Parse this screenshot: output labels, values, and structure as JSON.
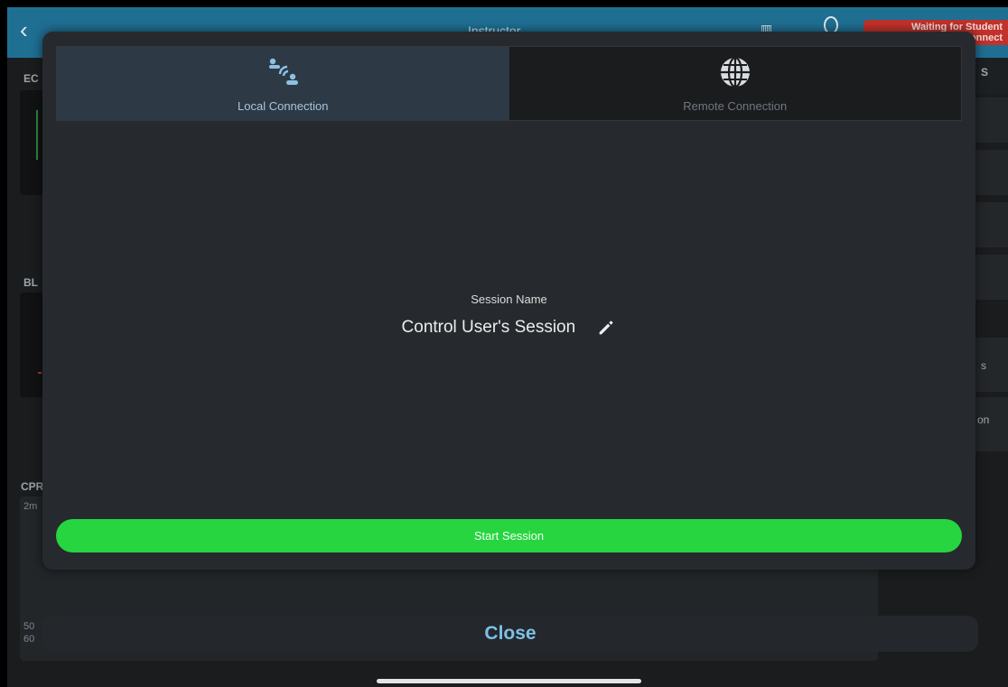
{
  "background": {
    "title": "Instructor",
    "status_badge": "Waiting for Student\nto Connect",
    "labels": {
      "ecg": "EC",
      "blood": "BL",
      "cpr": "CPR",
      "cpr_sub": "2m",
      "bottom_1": "50",
      "bottom_2": "60"
    },
    "right_texts": {
      "top": "S",
      "mid": "s",
      "low": "on"
    }
  },
  "modal": {
    "tabs": [
      {
        "label": "Local Connection",
        "icon": "local-connection-icon",
        "active": true
      },
      {
        "label": "Remote Connection",
        "icon": "globe-icon",
        "active": false
      }
    ],
    "session_label": "Session Name",
    "session_name": "Control User's Session",
    "start_button": "Start Session"
  },
  "close_button": "Close",
  "colors": {
    "accent_green": "#26d540",
    "header_blue": "#1f6f93",
    "badge_red": "#c0322b",
    "close_blue": "#7ec0e6"
  }
}
